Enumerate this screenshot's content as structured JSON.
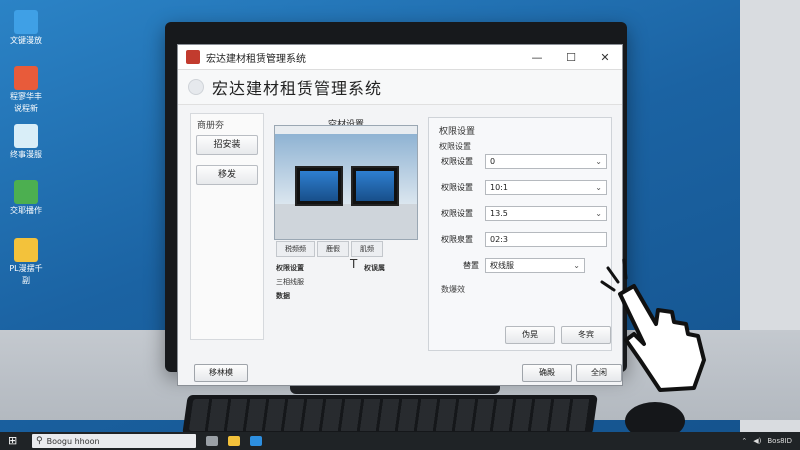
{
  "desktop": {
    "icons": [
      {
        "label": "文键漫放",
        "color": "#3fa0e6"
      },
      {
        "label": "程寥华丰",
        "sublabel": "说程新",
        "color": "#e85b3a"
      },
      {
        "label": "终事漫服",
        "color": "#d9eef8"
      },
      {
        "label": "交耶播作",
        "color": "#4caf50"
      },
      {
        "label": "PL漫摆千",
        "sublabel": "副",
        "color": "#f3c23b"
      }
    ]
  },
  "window": {
    "title": "宏达建材租赁管理系统",
    "header_title": "宏达建材租赁管理系统",
    "controls": {
      "minimize": "—",
      "maximize": "☐",
      "close": "✕"
    }
  },
  "left_panel": {
    "heading": "商册夯",
    "buttons": [
      "招安装",
      "移发"
    ]
  },
  "middle_panel": {
    "title": "空材设置",
    "tabs": [
      "税频频",
      "鹿假",
      "肌频"
    ],
    "tree": [
      "权限设置",
      "三相线服",
      "数据"
    ],
    "t_label": "权误属"
  },
  "right_panel": {
    "heading": "权限设置",
    "subheading": "权限设置",
    "rows": [
      {
        "label": "权限设置",
        "value": "0",
        "type": "select"
      },
      {
        "label": "权限设置",
        "value": "10:1",
        "type": "select"
      },
      {
        "label": "权限设置",
        "value": "13.5",
        "type": "select"
      },
      {
        "label": "权限泉置",
        "value": "02:3",
        "type": "input"
      },
      {
        "label": "替置",
        "value": "权线服",
        "type": "select"
      }
    ],
    "desc_label": "数爆效",
    "buttons": [
      "伪晃",
      "冬宾"
    ]
  },
  "footer_buttons": {
    "left": "移林模",
    "confirm": "确殿",
    "cancel": "全闲"
  },
  "taskbar": {
    "search_text": "Boogu hhoon",
    "tray_time": "Bos8ID"
  }
}
